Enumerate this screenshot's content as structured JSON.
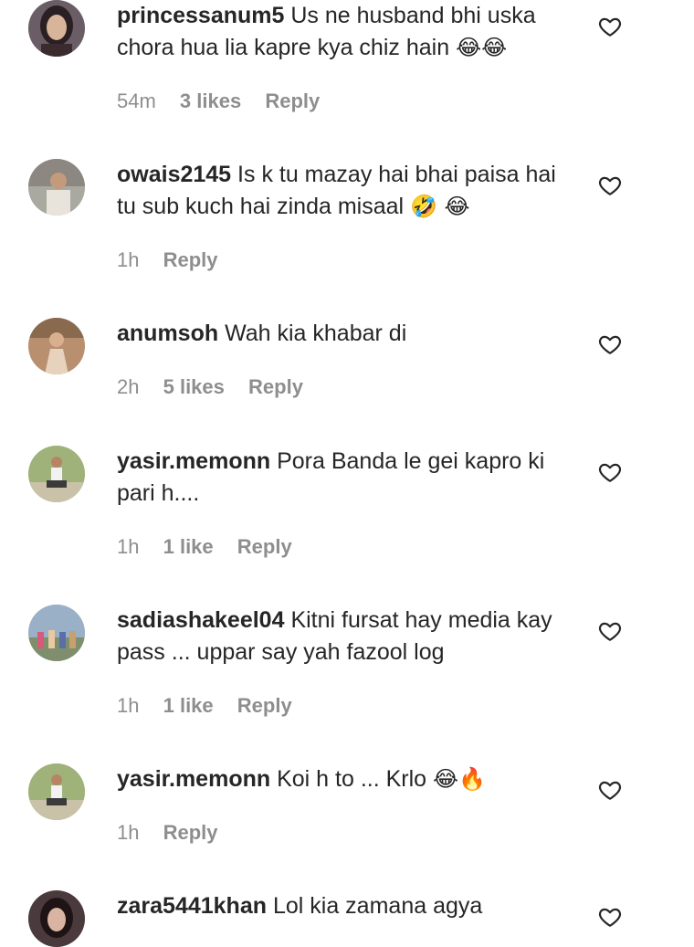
{
  "colors": {
    "text": "#262626",
    "meta": "#8e8e8e",
    "heart_outline": "#262626"
  },
  "comments": [
    {
      "username": "princessanum5",
      "text": "Us ne husband bhi uska chora hua lia kapre kya chiz hain",
      "emoji": "😂😂",
      "time": "54m",
      "likes": "3 likes",
      "reply": "Reply",
      "avatar_icon": "woman-portrait-avatar"
    },
    {
      "username": "owais2145",
      "text": "Is k tu mazay hai bhai paisa hai tu sub kuch hai zinda misaal",
      "emoji": "🤣 😂",
      "time": "1h",
      "likes": "",
      "reply": "Reply",
      "avatar_icon": "man-outdoor-avatar"
    },
    {
      "username": "anumsoh",
      "text": "Wah kia khabar di",
      "emoji": "",
      "time": "2h",
      "likes": "5 likes",
      "reply": "Reply",
      "avatar_icon": "woman-room-avatar"
    },
    {
      "username": "yasir.memonn",
      "text": "Pora Banda le gei kapro ki pari h....",
      "emoji": "",
      "time": "1h",
      "likes": "1 like",
      "reply": "Reply",
      "avatar_icon": "man-sitting-avatar"
    },
    {
      "username": "sadiashakeel04",
      "text": "Kitni fursat hay media kay pass ... uppar say yah fazool log",
      "emoji": "",
      "time": "1h",
      "likes": "1 like",
      "reply": "Reply",
      "avatar_icon": "group-photo-avatar"
    },
    {
      "username": "yasir.memonn",
      "text": "Koi h to ... Krlo",
      "emoji": "😂🔥",
      "time": "1h",
      "likes": "",
      "reply": "Reply",
      "avatar_icon": "man-sitting-avatar"
    },
    {
      "username": "zara5441khan",
      "text": "Lol kia zamana agya",
      "emoji": "",
      "time": "",
      "likes": "",
      "reply": "",
      "avatar_icon": "woman-dark-avatar"
    }
  ]
}
